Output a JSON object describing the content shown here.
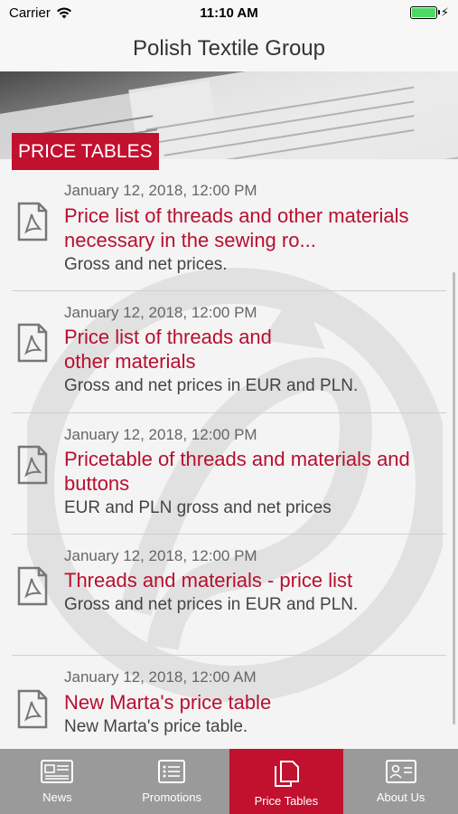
{
  "status_bar": {
    "carrier": "Carrier",
    "time": "11:10 AM"
  },
  "nav": {
    "title": "Polish Textile Group"
  },
  "section": {
    "badge": "PRICE TABLES"
  },
  "items": [
    {
      "date": "January 12, 2018, 12:00 PM",
      "title": "Price list of threads and other materials necessary in the sewing ro...",
      "subtitle": "Gross and net prices."
    },
    {
      "date": "January 12, 2018, 12:00 PM",
      "title": "Price list of threads and other materials",
      "subtitle": "Gross and net prices in EUR and PLN."
    },
    {
      "date": "January 12, 2018, 12:00 PM",
      "title": "Pricetable of threads and materials and buttons",
      "subtitle": "EUR and PLN gross and net prices"
    },
    {
      "date": "January 12, 2018, 12:00 PM",
      "title": "Threads and materials - price list",
      "subtitle": "Gross and net prices in EUR and PLN."
    },
    {
      "date": "January 12, 2018, 12:00 AM",
      "title": "New Marta's price table",
      "subtitle": "New Marta's price table."
    }
  ],
  "tabs": [
    {
      "label": "News",
      "icon": "newspaper-icon"
    },
    {
      "label": "Promotions",
      "icon": "list-icon"
    },
    {
      "label": "Price Tables",
      "icon": "documents-icon",
      "active": true
    },
    {
      "label": "About Us",
      "icon": "id-card-icon"
    }
  ],
  "colors": {
    "accent": "#c2102f",
    "tab_bar": "#9a9a9a",
    "title_text": "#b80f2f"
  }
}
